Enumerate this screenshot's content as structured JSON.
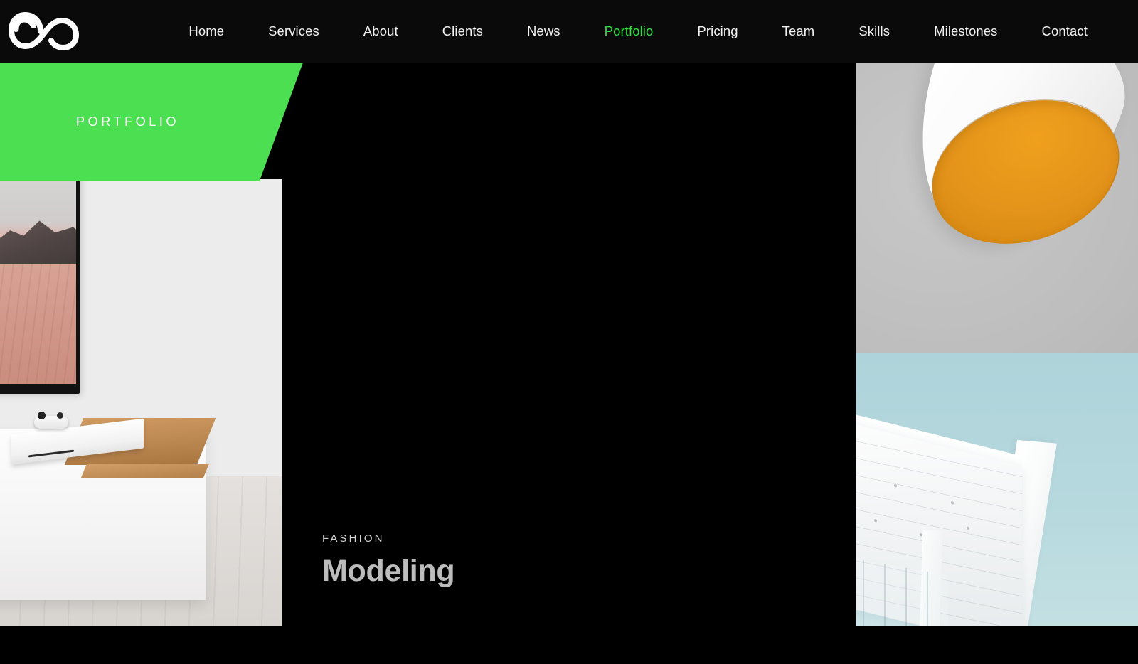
{
  "site": {
    "logo_icon": "infinity-loop-logo",
    "background_color": "#000000",
    "header_color": "#0a0a0a",
    "accent_color": "#33de44",
    "banner_color": "#4cdf51"
  },
  "nav": {
    "items": [
      {
        "label": "Home",
        "active": false
      },
      {
        "label": "Services",
        "active": false
      },
      {
        "label": "About",
        "active": false
      },
      {
        "label": "Clients",
        "active": false
      },
      {
        "label": "News",
        "active": false
      },
      {
        "label": "Portfolio",
        "active": true
      },
      {
        "label": "Pricing",
        "active": false
      },
      {
        "label": "Team",
        "active": false
      },
      {
        "label": "Skills",
        "active": false
      },
      {
        "label": "Milestones",
        "active": false
      },
      {
        "label": "Contact",
        "active": false
      }
    ]
  },
  "banner": {
    "label": "PORTFOLIO"
  },
  "featured": {
    "eyebrow": "FASHION",
    "title": "Modeling"
  },
  "gallery": {
    "items": [
      {
        "name": "living-room-console-tv",
        "alt": "White TV console with game console and desert wallpaper on screen"
      },
      {
        "name": "pendant-lamp",
        "alt": "White pendant lamp with orange interior on gray background"
      },
      {
        "name": "white-architecture",
        "alt": "White modern building roofline against pale blue sky"
      }
    ]
  }
}
